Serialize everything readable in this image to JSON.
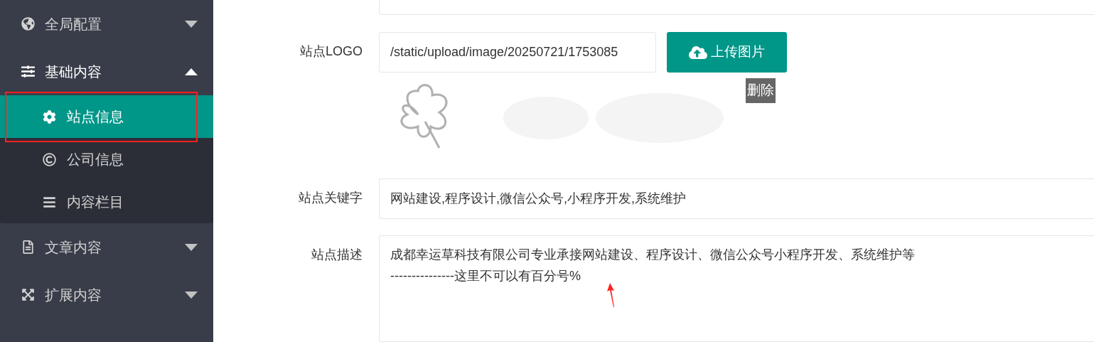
{
  "sidebar": {
    "items": [
      {
        "label": "全局配置",
        "expanded": false
      },
      {
        "label": "基础内容",
        "expanded": true,
        "children": [
          {
            "label": "站点信息",
            "selected": true
          },
          {
            "label": "公司信息",
            "selected": false
          },
          {
            "label": "内容栏目",
            "selected": false
          }
        ]
      },
      {
        "label": "文章内容",
        "expanded": false
      },
      {
        "label": "扩展内容",
        "expanded": false
      }
    ]
  },
  "form": {
    "fields": [
      {
        "kind": "logo",
        "label": "站点LOGO",
        "value": "/static/upload/image/20250721/1753085",
        "button": "上传图片",
        "delete": "删除"
      },
      {
        "kind": "input",
        "label": "站点关键字",
        "value": "网站建设,程序设计,微信公众号,小程序开发,系统维护"
      },
      {
        "kind": "textarea",
        "label": "站点描述",
        "lines": [
          "成都幸运草科技有限公司专业承接网站建设、程序设计、微信公众号小程序开发、系统维护等",
          "---------------这里不可以有百分号%"
        ]
      }
    ]
  }
}
